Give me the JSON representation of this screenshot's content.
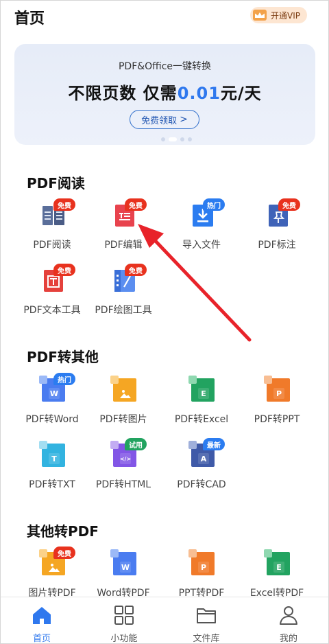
{
  "header": {
    "title": "首页",
    "vip_label": "开通VIP"
  },
  "banner": {
    "subtitle": "PDF&Office一键转换",
    "headline_prefix": "不限页数 仅需",
    "headline_price": "0.01",
    "headline_suffix": "元/天",
    "button_label": "免费领取",
    "button_arrow": ">"
  },
  "sections": {
    "pdf_read": {
      "title": "PDF阅读",
      "items": [
        {
          "label": "PDF阅读",
          "badge": "免费"
        },
        {
          "label": "PDF编辑",
          "badge": "免费"
        },
        {
          "label": "导入文件",
          "badge": "热门"
        },
        {
          "label": "PDF标注",
          "badge": "免费"
        },
        {
          "label": "PDF文本工具",
          "badge": "免费"
        },
        {
          "label": "PDF绘图工具",
          "badge": "免费"
        }
      ]
    },
    "pdf_to_other": {
      "title": "PDF转其他",
      "items": [
        {
          "label": "PDF转Word",
          "badge": "热门",
          "letter": "W"
        },
        {
          "label": "PDF转图片",
          "badge": "",
          "letter": ""
        },
        {
          "label": "PDF转Excel",
          "badge": "",
          "letter": "E"
        },
        {
          "label": "PDF转PPT",
          "badge": "",
          "letter": "P"
        },
        {
          "label": "PDF转TXT",
          "badge": "",
          "letter": "T"
        },
        {
          "label": "PDF转HTML",
          "badge": "试用",
          "letter": "</>"
        },
        {
          "label": "PDF转CAD",
          "badge": "最新",
          "letter": "A"
        }
      ]
    },
    "other_to_pdf": {
      "title": "其他转PDF",
      "items": [
        {
          "label": "图片转PDF",
          "badge": "免费",
          "letter": ""
        },
        {
          "label": "Word转PDF",
          "badge": "",
          "letter": "W"
        },
        {
          "label": "PPT转PDF",
          "badge": "",
          "letter": "P"
        },
        {
          "label": "Excel转PDF",
          "badge": "",
          "letter": "E"
        }
      ]
    }
  },
  "tabbar": {
    "tabs": [
      {
        "label": "首页",
        "icon": "home-icon"
      },
      {
        "label": "小功能",
        "icon": "grid-icon"
      },
      {
        "label": "文件库",
        "icon": "folder-icon"
      },
      {
        "label": "我的",
        "icon": "user-icon"
      }
    ],
    "active": "首页"
  },
  "colors": {
    "accent": "#2f78ee",
    "badge_red": "#e8321e",
    "badge_blue": "#2b7cf0",
    "badge_green": "#22a360",
    "annotation_arrow": "#e8232a"
  }
}
